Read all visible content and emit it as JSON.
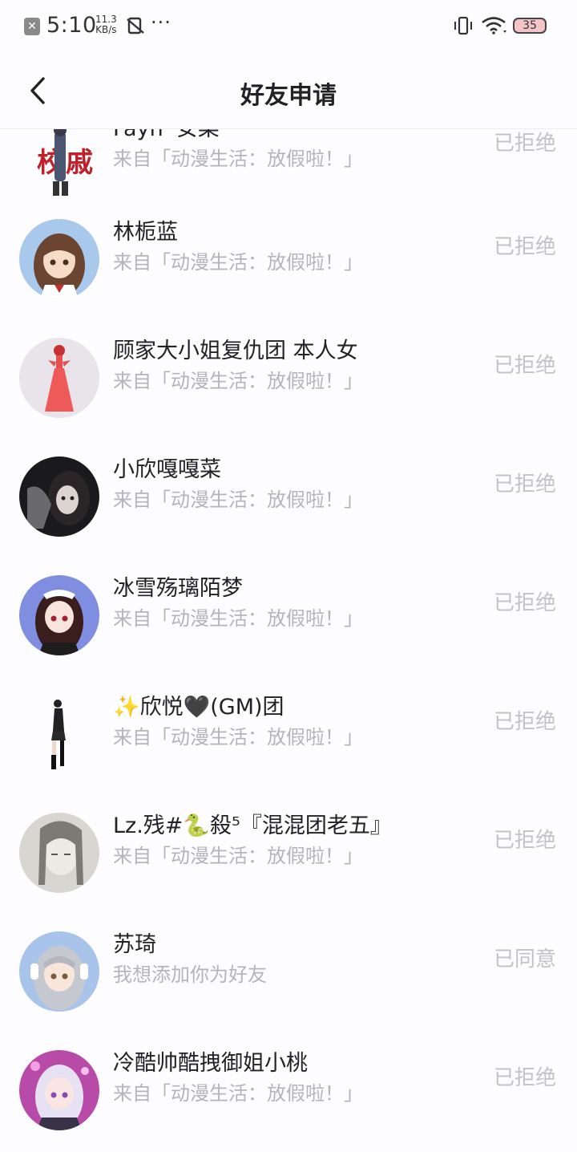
{
  "status_bar": {
    "time": "5:10",
    "net_speed_value": "11.3",
    "net_speed_unit": "KB/s",
    "dots": "···",
    "battery": "35"
  },
  "header": {
    "title": "好友申请"
  },
  "requests": [
    {
      "name": "Fayn' 安菜",
      "source": "来自「动漫生活：放假啦！」",
      "status": "已拒绝",
      "avatar_icon": "figure-red-icon"
    },
    {
      "name": "林栀蓝",
      "source": "来自「动漫生活：放假啦！」",
      "status": "已拒绝",
      "avatar_icon": "anime-girl-brown-hair-icon"
    },
    {
      "name": "顾家大小姐复仇团 本人女",
      "source": "来自「动漫生活：放假啦！」",
      "status": "已拒绝",
      "avatar_icon": "red-dress-figure-icon"
    },
    {
      "name": "小欣嘎嘎菜",
      "source": "来自「动漫生活：放假啦！」",
      "status": "已拒绝",
      "avatar_icon": "dark-photo-girl-icon"
    },
    {
      "name": "冰雪殇璃陌梦",
      "source": "来自「动漫生活：放假啦！」",
      "status": "已拒绝",
      "avatar_icon": "anime-girl-maid-icon"
    },
    {
      "name": "✨欣悦🖤(GM)团",
      "source": "来自「动漫生活：放假啦！」",
      "status": "已拒绝",
      "avatar_icon": "standing-figure-icon"
    },
    {
      "name": "Lz.残#🐍殺⁵『混混团老五』",
      "source": "来自「动漫生活：放假啦！」",
      "status": "已拒绝",
      "avatar_icon": "sketch-portrait-icon"
    },
    {
      "name": "苏琦",
      "source": "我想添加你为好友",
      "status": "已同意",
      "avatar_icon": "anime-girl-silver-hair-icon"
    },
    {
      "name": "冷酷帅酷拽御姐小桃",
      "source": "来自「动漫生活：放假啦！」",
      "status": "已拒绝",
      "avatar_icon": "anime-girl-purple-icon"
    }
  ],
  "colors": {
    "accent_text": "#222222",
    "secondary_text": "#b4b4bc",
    "status_text": "#c2c2c8"
  }
}
